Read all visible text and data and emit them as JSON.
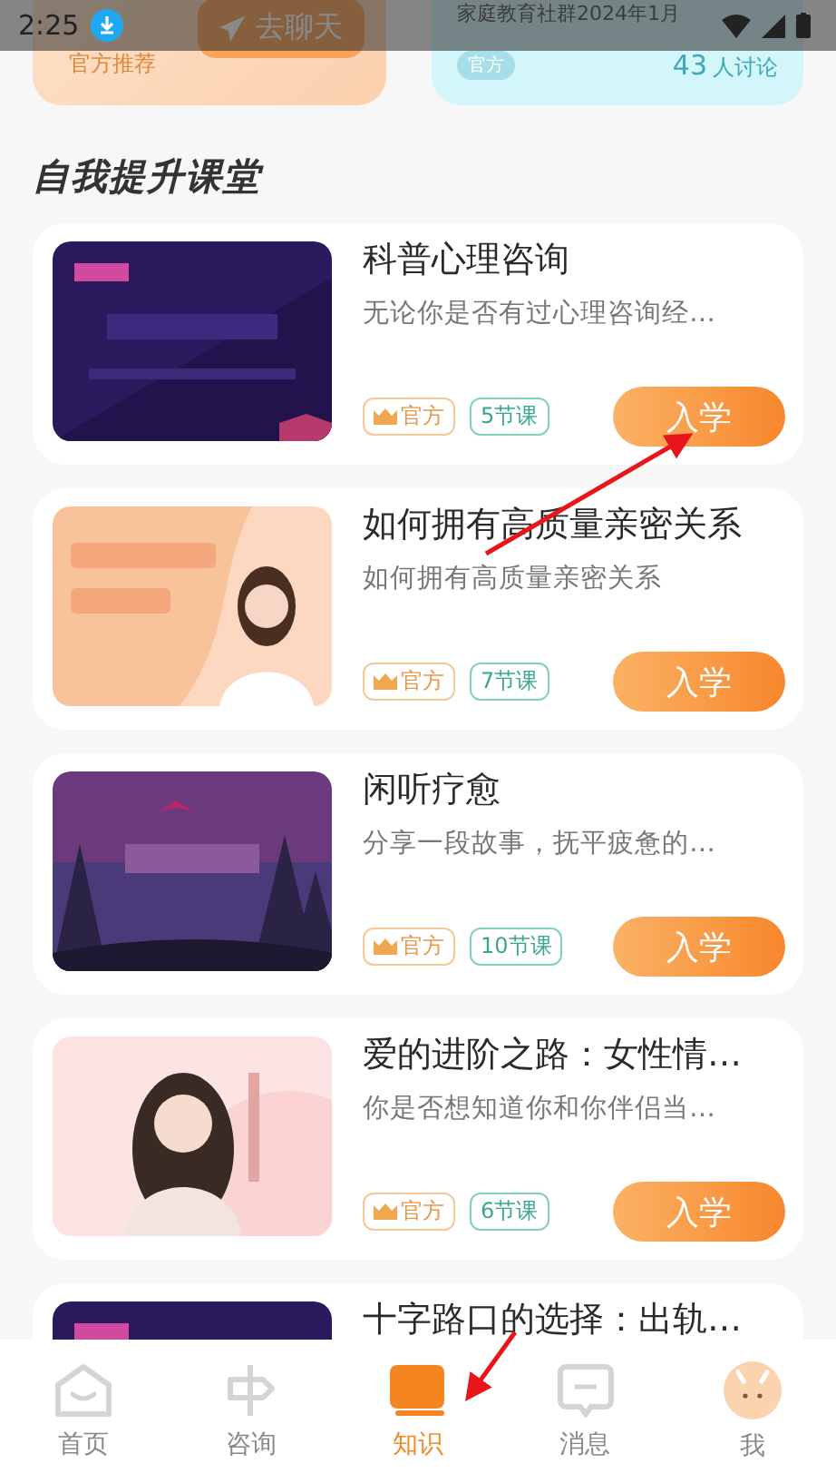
{
  "status_bar": {
    "time": "2:25"
  },
  "top_cards": [
    {
      "kind": "promo",
      "label": "官方推荐",
      "button": "去聊天"
    },
    {
      "kind": "group",
      "title": "家庭教育社群2024年1月",
      "badge": "官方",
      "count": "43",
      "count_suffix": "人讨论"
    }
  ],
  "section": {
    "title": "自我提升课堂"
  },
  "courses": [
    {
      "title": "科普心理咨询",
      "description": "无论你是否有过心理咨询经…",
      "badge": "官方",
      "lessons": "5节课",
      "button": "入学"
    },
    {
      "title": "如何拥有高质量亲密关系",
      "description": "如何拥有高质量亲密关系",
      "badge": "官方",
      "lessons": "7节课",
      "button": "入学"
    },
    {
      "title": "闲听疗愈",
      "description": "分享一段故事，抚平疲惫的…",
      "badge": "官方",
      "lessons": "10节课",
      "button": "入学"
    },
    {
      "title": "爱的进阶之路：女性情…",
      "description": "你是否想知道你和你伴侣当…",
      "badge": "官方",
      "lessons": "6节课",
      "button": "入学"
    },
    {
      "title": "十字路口的选择：出轨…"
    }
  ],
  "nav": [
    {
      "kind": "home",
      "label": "首页",
      "selected": false
    },
    {
      "kind": "consult",
      "label": "咨询",
      "selected": false
    },
    {
      "kind": "knowledge",
      "label": "知识",
      "selected": true
    },
    {
      "kind": "messages",
      "label": "消息",
      "selected": false
    },
    {
      "kind": "me",
      "label": "我",
      "selected": false
    }
  ]
}
